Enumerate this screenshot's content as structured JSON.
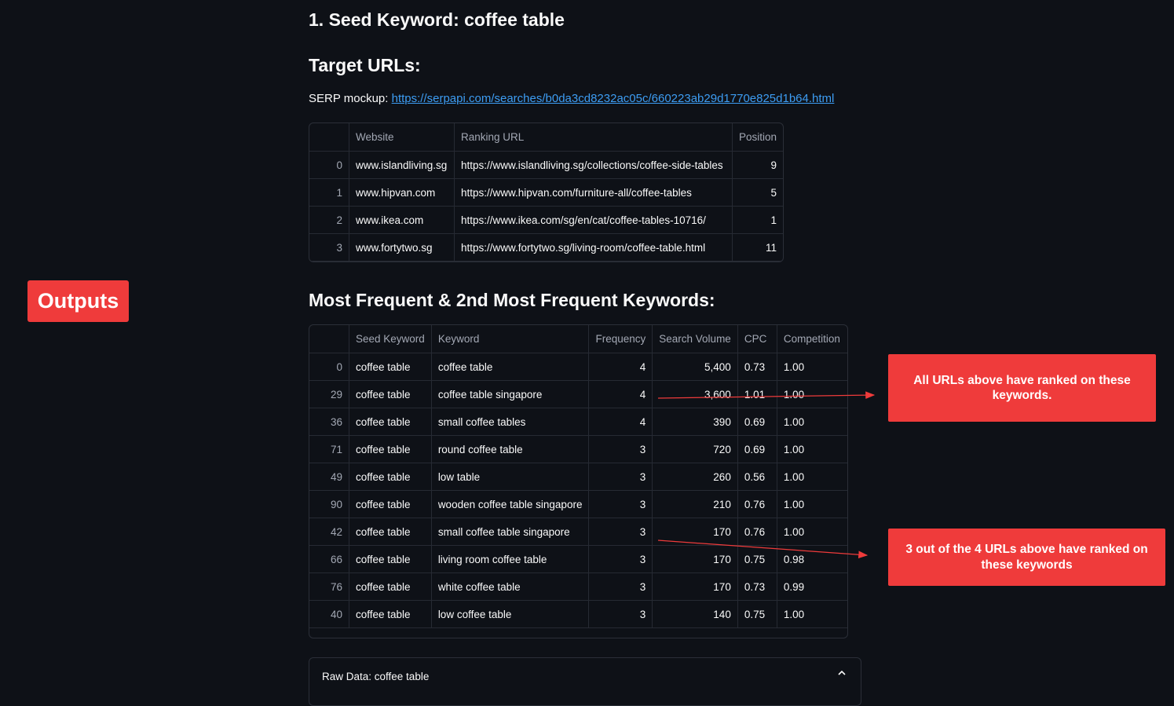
{
  "header": {
    "seed_title": "1. Seed Keyword: coffee table",
    "target_title": "Target URLs:",
    "serp_label": "SERP mockup: ",
    "serp_url": "https://serpapi.com/searches/b0da3cd8232ac05c/660223ab29d1770e825d1b64.html"
  },
  "urls_table": {
    "columns": [
      "",
      "Website",
      "Ranking URL",
      "Position"
    ],
    "rows": [
      [
        "0",
        "www.islandliving.sg",
        "https://www.islandliving.sg/collections/coffee-side-tables",
        "9"
      ],
      [
        "1",
        "www.hipvan.com",
        "https://www.hipvan.com/furniture-all/coffee-tables",
        "5"
      ],
      [
        "2",
        "www.ikea.com",
        "https://www.ikea.com/sg/en/cat/coffee-tables-10716/",
        "1"
      ],
      [
        "3",
        "www.fortytwo.sg",
        "https://www.fortytwo.sg/living-room/coffee-table.html",
        "11"
      ]
    ]
  },
  "freq_title": "Most Frequent & 2nd Most Frequent Keywords:",
  "kw_table": {
    "columns": [
      "",
      "Seed Keyword",
      "Keyword",
      "Frequency",
      "Search Volume",
      "CPC",
      "Competition"
    ],
    "rows": [
      [
        "0",
        "coffee table",
        "coffee table",
        "4",
        "5,400",
        "0.73",
        "1.00"
      ],
      [
        "29",
        "coffee table",
        "coffee table singapore",
        "4",
        "3,600",
        "1.01",
        "1.00"
      ],
      [
        "36",
        "coffee table",
        "small coffee tables",
        "4",
        "390",
        "0.69",
        "1.00"
      ],
      [
        "71",
        "coffee table",
        "round coffee table",
        "3",
        "720",
        "0.69",
        "1.00"
      ],
      [
        "49",
        "coffee table",
        "low table",
        "3",
        "260",
        "0.56",
        "1.00"
      ],
      [
        "90",
        "coffee table",
        "wooden coffee table singapore",
        "3",
        "210",
        "0.76",
        "1.00"
      ],
      [
        "42",
        "coffee table",
        "small coffee table singapore",
        "3",
        "170",
        "0.76",
        "1.00"
      ],
      [
        "66",
        "coffee table",
        "living room coffee table",
        "3",
        "170",
        "0.75",
        "0.98"
      ],
      [
        "76",
        "coffee table",
        "white coffee table",
        "3",
        "170",
        "0.73",
        "0.99"
      ],
      [
        "40",
        "coffee table",
        "low coffee table",
        "3",
        "140",
        "0.75",
        "1.00"
      ]
    ]
  },
  "expander": {
    "label": "Raw Data: coffee table",
    "icon": "chevron-up-icon"
  },
  "annotations": {
    "outputs_badge": "Outputs",
    "callout_1": "All URLs above have ranked on these keywords.",
    "callout_2": "3 out of the 4 URLs above have ranked on these keywords",
    "accent_color": "#ef3b3b"
  }
}
